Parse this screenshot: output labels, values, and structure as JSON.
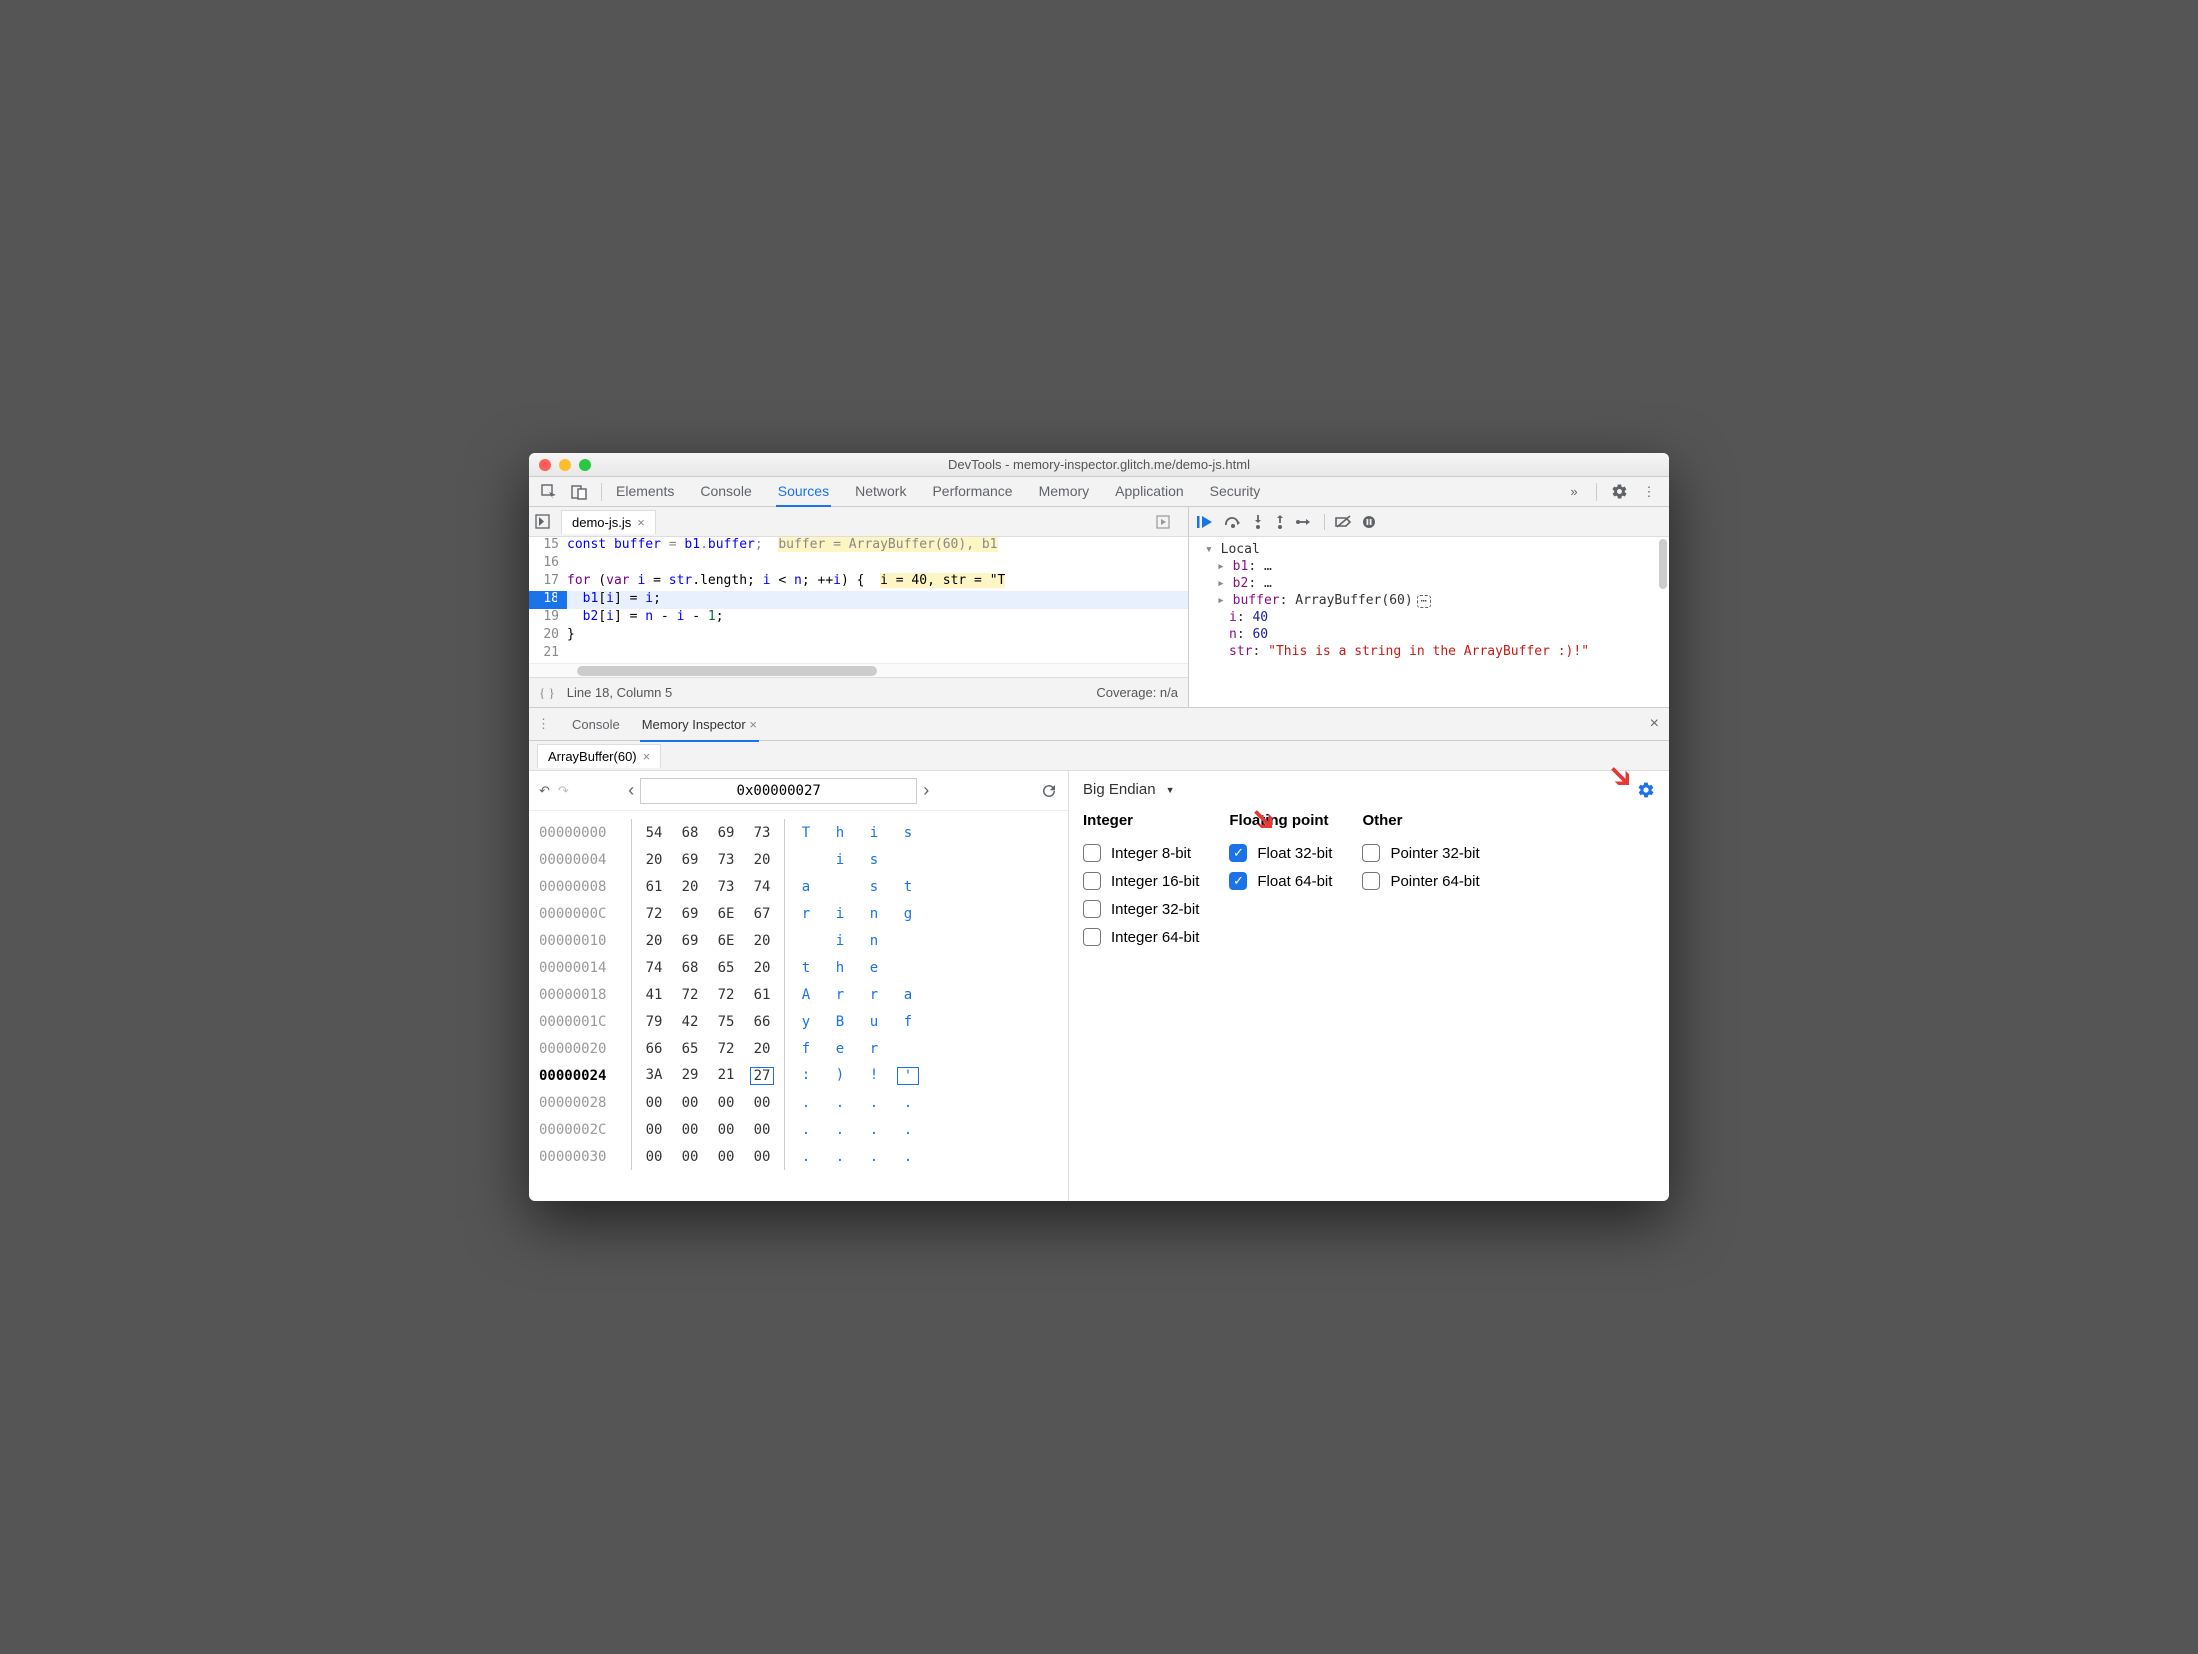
{
  "window_title": "DevTools - memory-inspector.glitch.me/demo-js.html",
  "main_tabs": [
    "Elements",
    "Console",
    "Sources",
    "Network",
    "Performance",
    "Memory",
    "Application",
    "Security"
  ],
  "main_tab_active": "Sources",
  "file_tab": "demo-js.js",
  "code": {
    "lines": [
      {
        "n": 15,
        "dim": true,
        "text": "const buffer = b1.buffer;  buffer = ArrayBuffer(60), b1"
      },
      {
        "n": 16,
        "text": ""
      },
      {
        "n": 17,
        "text": "for (var i = str.length; i < n; ++i) {  i = 40, str = \"T"
      },
      {
        "n": 18,
        "hl": true,
        "text": "  b1[i] = i;"
      },
      {
        "n": 19,
        "text": "  b2[i] = n - i - 1;"
      },
      {
        "n": 20,
        "text": "}"
      },
      {
        "n": 21,
        "text": ""
      }
    ]
  },
  "status_left": "Line 18, Column 5",
  "status_right": "Coverage: n/a",
  "scope": {
    "header": "Local",
    "items": [
      {
        "name": "b1",
        "val": "…",
        "exp": true
      },
      {
        "name": "b2",
        "val": "…",
        "exp": true
      },
      {
        "name": "buffer",
        "val": "ArrayBuffer(60)",
        "exp": true,
        "icon": true
      },
      {
        "name": "i",
        "val": "40",
        "num": true
      },
      {
        "name": "n",
        "val": "60",
        "num": true
      },
      {
        "name": "str",
        "val": "\"This is a string in the ArrayBuffer :)!\"",
        "str": true
      }
    ]
  },
  "drawer_tabs": [
    "Console",
    "Memory Inspector"
  ],
  "drawer_active": "Memory Inspector",
  "memory_tab": "ArrayBuffer(60)",
  "mem_address": "0x00000027",
  "hex_rows": [
    {
      "addr": "00000000",
      "b": [
        "54",
        "68",
        "69",
        "73"
      ],
      "a": [
        "T",
        "h",
        "i",
        "s"
      ]
    },
    {
      "addr": "00000004",
      "b": [
        "20",
        "69",
        "73",
        "20"
      ],
      "a": [
        " ",
        "i",
        "s",
        " "
      ]
    },
    {
      "addr": "00000008",
      "b": [
        "61",
        "20",
        "73",
        "74"
      ],
      "a": [
        "a",
        " ",
        "s",
        "t"
      ]
    },
    {
      "addr": "0000000C",
      "b": [
        "72",
        "69",
        "6E",
        "67"
      ],
      "a": [
        "r",
        "i",
        "n",
        "g"
      ]
    },
    {
      "addr": "00000010",
      "b": [
        "20",
        "69",
        "6E",
        "20"
      ],
      "a": [
        " ",
        "i",
        "n",
        " "
      ]
    },
    {
      "addr": "00000014",
      "b": [
        "74",
        "68",
        "65",
        "20"
      ],
      "a": [
        "t",
        "h",
        "e",
        " "
      ]
    },
    {
      "addr": "00000018",
      "b": [
        "41",
        "72",
        "72",
        "61"
      ],
      "a": [
        "A",
        "r",
        "r",
        "a"
      ]
    },
    {
      "addr": "0000001C",
      "b": [
        "79",
        "42",
        "75",
        "66"
      ],
      "a": [
        "y",
        "B",
        "u",
        "f"
      ]
    },
    {
      "addr": "00000020",
      "b": [
        "66",
        "65",
        "72",
        "20"
      ],
      "a": [
        "f",
        "e",
        "r",
        " "
      ]
    },
    {
      "addr": "00000024",
      "b": [
        "3A",
        "29",
        "21",
        "27"
      ],
      "a": [
        ":",
        ")",
        "!",
        "'"
      ],
      "cur": true,
      "box": [
        3,
        3
      ]
    },
    {
      "addr": "00000028",
      "b": [
        "00",
        "00",
        "00",
        "00"
      ],
      "a": [
        ".",
        ".",
        ".",
        "."
      ]
    },
    {
      "addr": "0000002C",
      "b": [
        "00",
        "00",
        "00",
        "00"
      ],
      "a": [
        ".",
        ".",
        ".",
        "."
      ]
    },
    {
      "addr": "00000030",
      "b": [
        "00",
        "00",
        "00",
        "00"
      ],
      "a": [
        ".",
        ".",
        ".",
        "."
      ]
    }
  ],
  "endian": "Big Endian",
  "value_groups": [
    {
      "title": "Integer",
      "items": [
        {
          "label": "Integer 8-bit",
          "on": false
        },
        {
          "label": "Integer 16-bit",
          "on": false
        },
        {
          "label": "Integer 32-bit",
          "on": false
        },
        {
          "label": "Integer 64-bit",
          "on": false
        }
      ]
    },
    {
      "title": "Floating point",
      "items": [
        {
          "label": "Float 32-bit",
          "on": true
        },
        {
          "label": "Float 64-bit",
          "on": true
        }
      ]
    },
    {
      "title": "Other",
      "items": [
        {
          "label": "Pointer 32-bit",
          "on": false
        },
        {
          "label": "Pointer 64-bit",
          "on": false
        }
      ]
    }
  ]
}
